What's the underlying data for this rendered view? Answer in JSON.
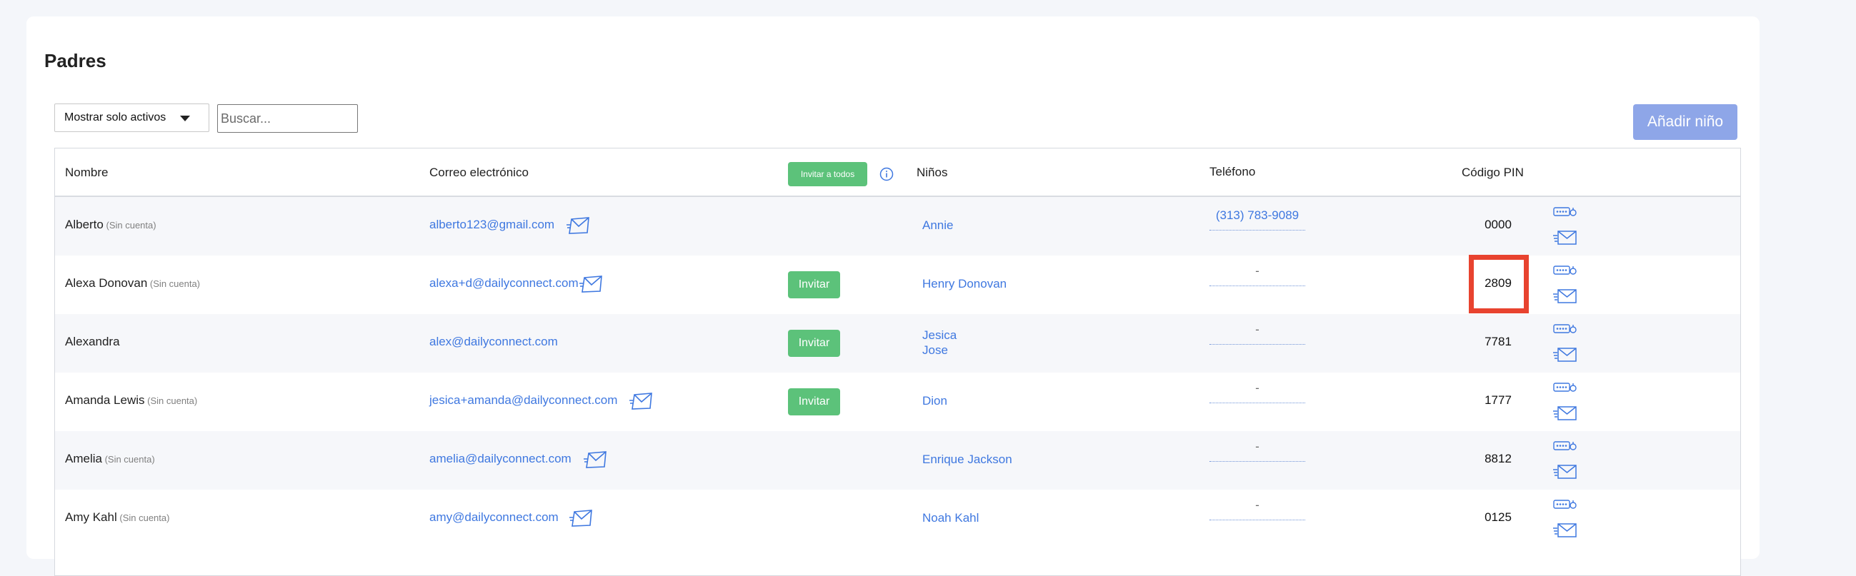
{
  "page": {
    "title": "Padres"
  },
  "toolbar": {
    "filter_value": "Mostrar solo activos",
    "search_placeholder": "Buscar...",
    "add_child_label": "Añadir niño"
  },
  "table": {
    "headers": {
      "name": "Nombre",
      "email": "Correo electrónico",
      "invite_all": "Invitar a todos",
      "kids": "Niños",
      "phone": "Teléfono",
      "pin": "Código PIN"
    },
    "no_account_note": "(Sin cuenta)",
    "invite_label": "Invitar",
    "empty_phone": "-",
    "rows": [
      {
        "name": "Alberto",
        "no_account": true,
        "email": "alberto123@gmail.com",
        "has_invite": false,
        "kids": [
          "Annie"
        ],
        "phone": "(313) 783-9089",
        "pin": "0000"
      },
      {
        "name": "Alexa Donovan",
        "no_account": true,
        "email": "alexa+d@dailyconnect.com",
        "has_invite": true,
        "kids": [
          "Henry Donovan"
        ],
        "phone": "",
        "pin": "2809"
      },
      {
        "name": "Alexandra",
        "no_account": false,
        "email": "alex@dailyconnect.com",
        "has_invite": true,
        "kids": [
          "Jesica",
          "Jose"
        ],
        "phone": "",
        "pin": "7781"
      },
      {
        "name": "Amanda Lewis",
        "no_account": true,
        "email": "jesica+amanda@dailyconnect.com",
        "has_invite": true,
        "kids": [
          "Dion"
        ],
        "phone": "",
        "pin": "1777"
      },
      {
        "name": "Amelia",
        "no_account": true,
        "email": "amelia@dailyconnect.com",
        "has_invite": false,
        "kids": [
          "Enrique Jackson"
        ],
        "phone": "",
        "pin": "8812"
      },
      {
        "name": "Amy Kahl",
        "no_account": true,
        "email": "amy@dailyconnect.com",
        "has_invite": false,
        "kids": [
          "Noah Kahl"
        ],
        "phone": "",
        "pin": "0125"
      }
    ]
  },
  "colors": {
    "link": "#3f78e0",
    "invite_green": "#5cc27a",
    "add_button": "#8ea6e8",
    "highlight": "#e8432f"
  },
  "icons": {
    "send_email": "send-email-icon",
    "info": "info-icon",
    "pin_key": "pin-key-icon",
    "pin_email": "pin-email-icon",
    "dropdown": "chevron-down-icon"
  }
}
